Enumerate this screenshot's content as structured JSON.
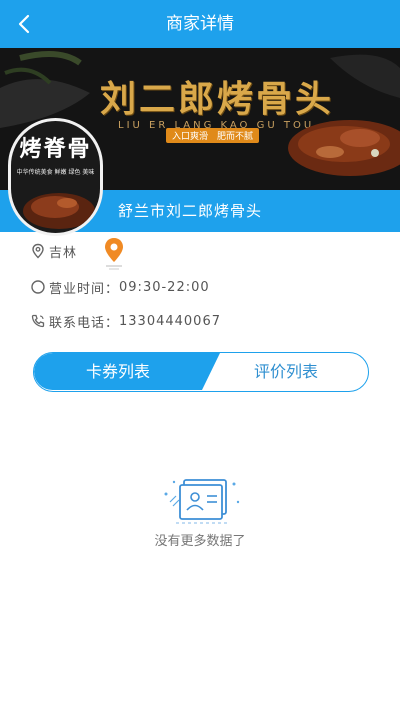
{
  "header": {
    "title": "商家详情",
    "back_icon": "back-arrow-icon"
  },
  "banner": {
    "title": "刘二郎烤骨头",
    "pinyin": "LIU ER LANG KAO GU TOU",
    "tagline": "入口爽滑　肥而不腻",
    "logo_text": "烤脊骨",
    "logo_sub": "中华传统美食 鲜嫩 绿色 美味"
  },
  "merchant": {
    "name": "舒兰市刘二郎烤骨头"
  },
  "info": {
    "location": "吉林",
    "hours_label": "营业时间：",
    "hours": "09:30-22:00",
    "phone_label": "联系电话：",
    "phone": "13304440067"
  },
  "tabs": [
    {
      "label": "卡券列表",
      "active": true
    },
    {
      "label": "评价列表",
      "active": false
    }
  ],
  "empty": {
    "text": "没有更多数据了",
    "icon": "empty-card-icon"
  },
  "colors": {
    "primary": "#1ea1ec",
    "banner_gold": "#d9a84a",
    "pin_orange": "#f08a24"
  }
}
